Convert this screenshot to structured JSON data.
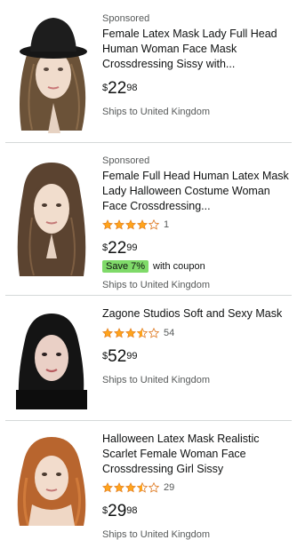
{
  "results": [
    {
      "sponsored": "Sponsored",
      "title": "Female Latex Mask Lady Full Head Human Woman Face Mask Crossdressing Sissy with...",
      "price": {
        "symbol": "$",
        "whole": "22",
        "fraction": "98"
      },
      "shipping": "Ships to United Kingdom",
      "image_icon": "black-hat-latex-mask-image"
    },
    {
      "sponsored": "Sponsored",
      "title": "Female Full Head Human Latex Mask Lady Halloween Costume Woman Face Crossdressing...",
      "rating": {
        "stars": 4.0,
        "count": "1"
      },
      "price": {
        "symbol": "$",
        "whole": "22",
        "fraction": "99"
      },
      "coupon": {
        "badge": "Save 7%",
        "text": "with coupon"
      },
      "shipping": "Ships to United Kingdom",
      "image_icon": "brown-hair-latex-mask-image"
    },
    {
      "title": "Zagone Studios Soft and Sexy Mask",
      "rating": {
        "stars": 3.5,
        "count": "54"
      },
      "price": {
        "symbol": "$",
        "whole": "52",
        "fraction": "99"
      },
      "shipping": "Ships to United Kingdom",
      "image_icon": "black-hair-mask-image"
    },
    {
      "title": "Halloween Latex Mask Realistic Scarlet Female Woman Face Crossdressing Girl Sissy",
      "rating": {
        "stars": 3.5,
        "count": "29"
      },
      "price": {
        "symbol": "$",
        "whole": "29",
        "fraction": "98"
      },
      "shipping": "Ships to United Kingdom",
      "image_icon": "red-hair-mask-image"
    }
  ],
  "colors": {
    "star": "#ffa41c",
    "coupon_badge": "#7fda69",
    "divider": "#d5d9d9"
  }
}
